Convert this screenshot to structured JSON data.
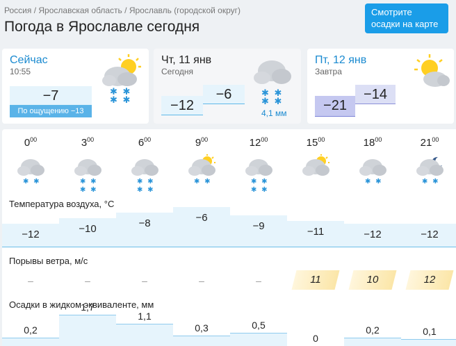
{
  "breadcrumb": [
    "Россия",
    "Ярославская область",
    "Ярославль (городской округ)"
  ],
  "breadcrumb_sep": "/",
  "title": "Погода в Ярославле сегодня",
  "map_button": "Смотрите осадки на карте",
  "now": {
    "title": "Сейчас",
    "time": "10:55",
    "temp": "−7",
    "feels": "По ощущению −13"
  },
  "today": {
    "title": "Чт, 11 янв",
    "sub": "Сегодня",
    "min": "−12",
    "max": "−6",
    "precip": "4,1 мм"
  },
  "tomorrow": {
    "title": "Пт, 12 янв",
    "sub": "Завтра",
    "min": "−21",
    "max": "−14"
  },
  "hourly": {
    "hours": [
      "0",
      "3",
      "6",
      "9",
      "12",
      "15",
      "18",
      "21"
    ],
    "hour_suffix": "00",
    "icons": [
      "cloud-snow-icon",
      "cloud-snow-icon",
      "cloud-snow-icon",
      "sun-cloud-snow-icon",
      "cloud-snow-icon",
      "sun-cloud-icon",
      "cloud-snow-icon",
      "moon-cloud-snow-icon"
    ],
    "temp_label": "Температура воздуха, °C",
    "temps": [
      "−12",
      "−10",
      "−8",
      "−6",
      "−9",
      "−11",
      "−12",
      "−12"
    ],
    "temp_values": [
      -12,
      -10,
      -8,
      -6,
      -9,
      -11,
      -12,
      -12
    ],
    "gust_label": "Порывы ветра, м/с",
    "gusts": [
      "–",
      "–",
      "–",
      "–",
      "–",
      "11",
      "10",
      "12"
    ],
    "precip_label": "Осадки в жидком эквиваленте, мм",
    "precip": [
      "0,2",
      "1,7",
      "1,1",
      "0,3",
      "0,5",
      "0",
      "0,2",
      "0,1"
    ],
    "precip_values": [
      0.2,
      1.7,
      1.1,
      0.3,
      0.5,
      0,
      0.2,
      0.1
    ]
  },
  "colors": {
    "accent": "#1a9de8",
    "temp_fill": "#e6f4fc",
    "gust_fill": "#fbe6a8",
    "tomorrow_fill": "#c5c8f0"
  }
}
